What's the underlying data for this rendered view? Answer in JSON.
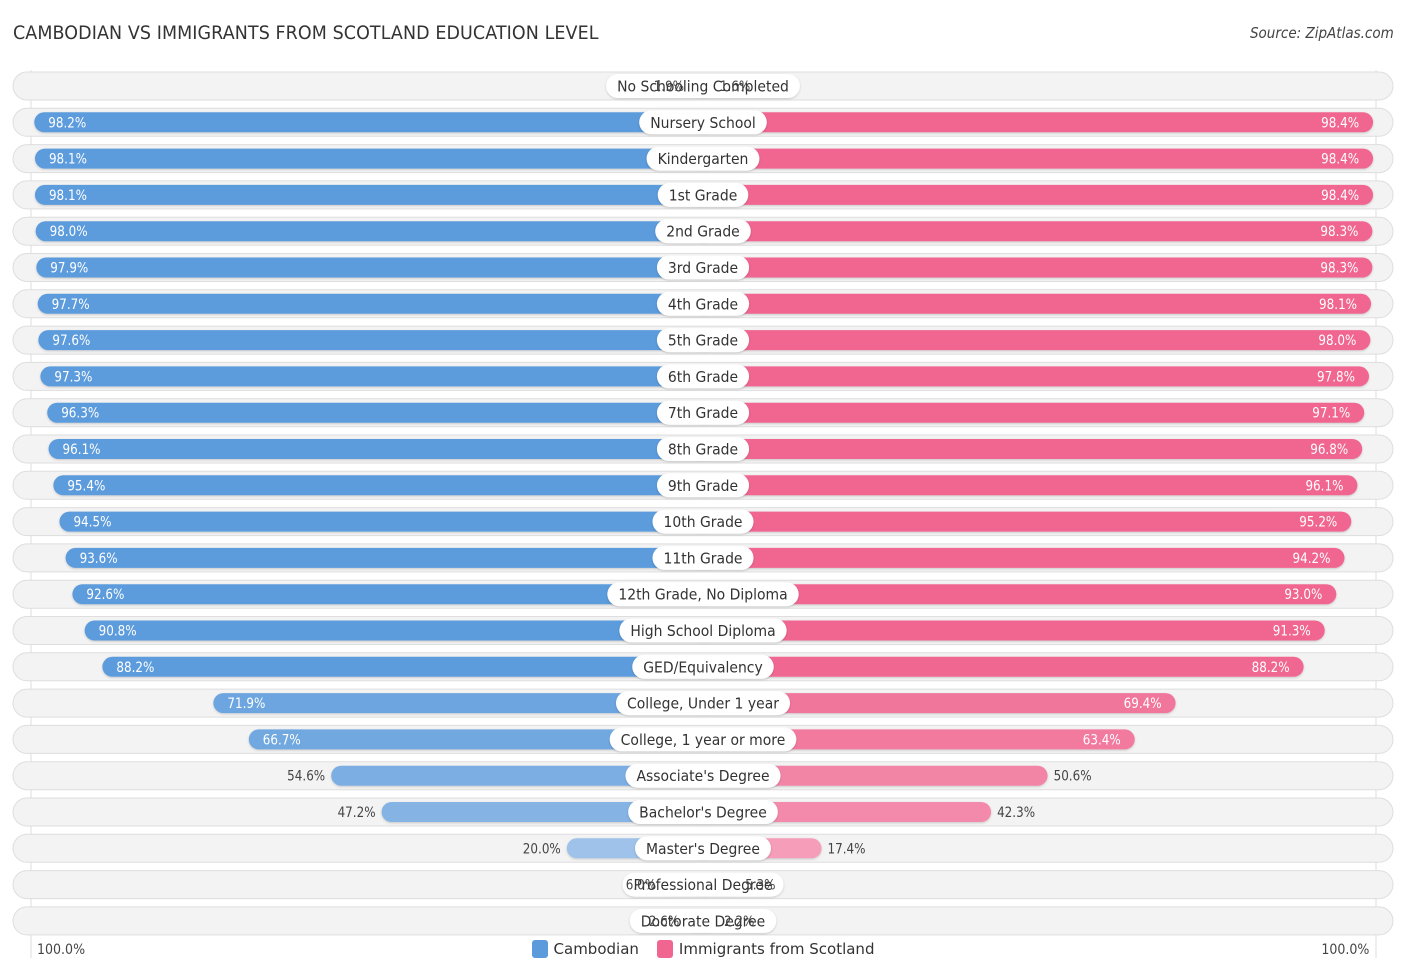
{
  "header": {
    "title": "CAMBODIAN VS IMMIGRANTS FROM SCOTLAND EDUCATION LEVEL",
    "source": "Source: ZipAtlas.com"
  },
  "colors": {
    "cambodian": "#5b9bdc",
    "cambodian_light": "#a7c7eb",
    "scotland": "#f06690",
    "scotland_light": "#f5a3bd"
  },
  "legend": {
    "series1": "Cambodian",
    "series2": "Immigrants from Scotland"
  },
  "axis": {
    "left_label": "100.0%",
    "right_label": "100.0%"
  },
  "chart_data": {
    "type": "bar",
    "orientation": "horizontal-diverging",
    "title": "CAMBODIAN VS IMMIGRANTS FROM SCOTLAND EDUCATION LEVEL",
    "xlabel": "",
    "ylabel": "",
    "xlim": [
      0,
      100
    ],
    "legend_position": "bottom-center",
    "categories": [
      "No Schooling Completed",
      "Nursery School",
      "Kindergarten",
      "1st Grade",
      "2nd Grade",
      "3rd Grade",
      "4th Grade",
      "5th Grade",
      "6th Grade",
      "7th Grade",
      "8th Grade",
      "9th Grade",
      "10th Grade",
      "11th Grade",
      "12th Grade, No Diploma",
      "High School Diploma",
      "GED/Equivalency",
      "College, Under 1 year",
      "College, 1 year or more",
      "Associate's Degree",
      "Bachelor's Degree",
      "Master's Degree",
      "Professional Degree",
      "Doctorate Degree"
    ],
    "series": [
      {
        "name": "Cambodian",
        "side": "left",
        "values": [
          1.9,
          98.2,
          98.1,
          98.1,
          98.0,
          97.9,
          97.7,
          97.6,
          97.3,
          96.3,
          96.1,
          95.4,
          94.5,
          93.6,
          92.6,
          90.8,
          88.2,
          71.9,
          66.7,
          54.6,
          47.2,
          20.0,
          6.0,
          2.6
        ],
        "labels": [
          "1.9%",
          "98.2%",
          "98.1%",
          "98.1%",
          "98.0%",
          "97.9%",
          "97.7%",
          "97.6%",
          "97.3%",
          "96.3%",
          "96.1%",
          "95.4%",
          "94.5%",
          "93.6%",
          "92.6%",
          "90.8%",
          "88.2%",
          "71.9%",
          "66.7%",
          "54.6%",
          "47.2%",
          "20.0%",
          "6.0%",
          "2.6%"
        ]
      },
      {
        "name": "Immigrants from Scotland",
        "side": "right",
        "values": [
          1.6,
          98.4,
          98.4,
          98.4,
          98.3,
          98.3,
          98.1,
          98.0,
          97.8,
          97.1,
          96.8,
          96.1,
          95.2,
          94.2,
          93.0,
          91.3,
          88.2,
          69.4,
          63.4,
          50.6,
          42.3,
          17.4,
          5.3,
          2.2
        ],
        "labels": [
          "1.6%",
          "98.4%",
          "98.4%",
          "98.4%",
          "98.3%",
          "98.3%",
          "98.1%",
          "98.0%",
          "97.8%",
          "97.1%",
          "96.8%",
          "96.1%",
          "95.2%",
          "94.2%",
          "93.0%",
          "91.3%",
          "88.2%",
          "69.4%",
          "63.4%",
          "50.6%",
          "42.3%",
          "17.4%",
          "5.3%",
          "2.2%"
        ]
      }
    ]
  }
}
